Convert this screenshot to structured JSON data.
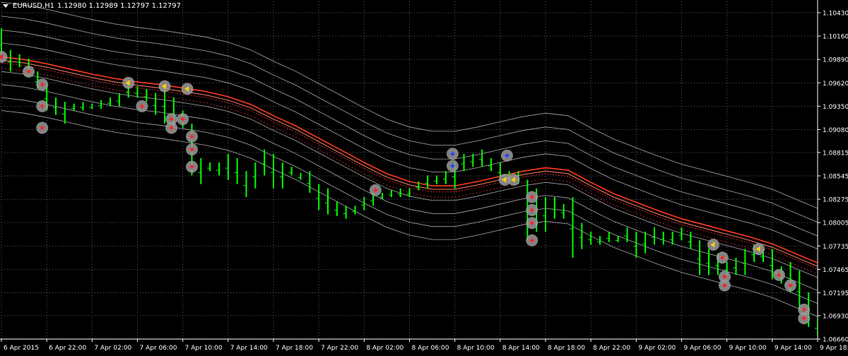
{
  "header": {
    "symbol": "EURUSD,H1",
    "ohlc": "1.12980 1.12989 1.12797 1.12797"
  },
  "colors": {
    "background": "#000000",
    "grid": "#5a5a7a",
    "axis_text": "#ffffff",
    "candle": "#00ff00",
    "envelope": "#c8c8c8",
    "ma_main": "#ff3c1e",
    "ma_dash": "#ff2a2a",
    "marker_ring": "#a0a0a0",
    "marker_red": "#ff2020",
    "marker_blue": "#2040ff",
    "marker_yellow": "#ffd000"
  },
  "chart_data": {
    "type": "candlestick",
    "y_ticks": [
      "1.10430",
      "1.10160",
      "1.09890",
      "1.09620",
      "1.09350",
      "1.09080",
      "1.08815",
      "1.08545",
      "1.08275",
      "1.08005",
      "1.07735",
      "1.07465",
      "1.07195",
      "1.06930",
      "1.06660"
    ],
    "x_ticks": [
      "6 Apr 2015",
      "6 Apr 22:00",
      "7 Apr 02:00",
      "7 Apr 06:00",
      "7 Apr 10:00",
      "7 Apr 14:00",
      "7 Apr 18:00",
      "7 Apr 22:00",
      "8 Apr 02:00",
      "8 Apr 06:00",
      "8 Apr 10:00",
      "8 Apr 14:00",
      "8 Apr 18:00",
      "8 Apr 22:00",
      "9 Apr 02:00",
      "9 Apr 06:00",
      "9 Apr 10:00",
      "9 Apr 14:00",
      "9 Apr 18:00"
    ],
    "ylim": [
      1.0666,
      1.1043
    ],
    "ma_curve": [
      [
        0,
        1.099
      ],
      [
        0.5,
        1.0987
      ],
      [
        1,
        1.0982
      ],
      [
        1.5,
        1.0976
      ],
      [
        2,
        1.097
      ],
      [
        2.5,
        1.0965
      ],
      [
        3,
        1.0961
      ],
      [
        3.5,
        1.0958
      ],
      [
        4,
        1.0954
      ],
      [
        4.5,
        1.095
      ],
      [
        5,
        1.0944
      ],
      [
        5.5,
        1.0935
      ],
      [
        6,
        1.0922
      ],
      [
        6.5,
        1.091
      ],
      [
        7,
        1.0896
      ],
      [
        7.5,
        1.0882
      ],
      [
        8,
        1.0868
      ],
      [
        8.5,
        1.0855
      ],
      [
        9,
        1.0846
      ],
      [
        9.5,
        1.0841
      ],
      [
        10,
        1.0841
      ],
      [
        10.5,
        1.0846
      ],
      [
        11,
        1.0852
      ],
      [
        11.5,
        1.0858
      ],
      [
        12,
        1.0862
      ],
      [
        12.5,
        1.0859
      ],
      [
        13,
        1.0845
      ],
      [
        13.5,
        1.0832
      ],
      [
        14,
        1.0822
      ],
      [
        14.5,
        1.0812
      ],
      [
        15,
        1.0803
      ],
      [
        15.5,
        1.0796
      ],
      [
        16,
        1.0789
      ],
      [
        16.5,
        1.0782
      ],
      [
        17,
        1.0774
      ],
      [
        17.5,
        1.0763
      ],
      [
        18,
        1.0752
      ],
      [
        18.4,
        1.0747
      ]
    ],
    "envelope_offsets": [
      0.0065,
      0.0049,
      0.0033,
      0.0018,
      -0.0015,
      -0.003,
      -0.0045,
      -0.006
    ],
    "candles": [
      [
        0,
        1.1025,
        1.099
      ],
      [
        0.2,
        1.1,
        1.0975
      ],
      [
        0.4,
        1.0995,
        1.098
      ],
      [
        0.6,
        1.099,
        1.097
      ],
      [
        0.8,
        1.0975,
        1.0955
      ],
      [
        1,
        1.096,
        1.093
      ],
      [
        1.2,
        1.0945,
        1.0925
      ],
      [
        1.4,
        1.094,
        1.0915
      ],
      [
        1.6,
        1.0938,
        1.093
      ],
      [
        1.8,
        1.094,
        1.093
      ],
      [
        2,
        1.0938,
        1.0932
      ],
      [
        2.2,
        1.0942,
        1.0932
      ],
      [
        2.4,
        1.0945,
        1.0935
      ],
      [
        2.6,
        1.095,
        1.0935
      ],
      [
        2.8,
        1.096,
        1.0945
      ],
      [
        3,
        1.0958,
        1.0945
      ],
      [
        3.2,
        1.0955,
        1.094
      ],
      [
        3.4,
        1.095,
        1.0925
      ],
      [
        3.6,
        1.0958,
        1.0915
      ],
      [
        3.8,
        1.0945,
        1.091
      ],
      [
        4,
        1.093,
        1.091
      ],
      [
        4.2,
        1.0915,
        1.0855
      ],
      [
        4.4,
        1.0875,
        1.0845
      ],
      [
        4.6,
        1.087,
        1.086
      ],
      [
        4.8,
        1.087,
        1.0855
      ],
      [
        5,
        1.088,
        1.085
      ],
      [
        5.2,
        1.0875,
        1.0845
      ],
      [
        5.4,
        1.086,
        1.083
      ],
      [
        5.6,
        1.087,
        1.084
      ],
      [
        5.8,
        1.0885,
        1.0855
      ],
      [
        6,
        1.088,
        1.084
      ],
      [
        6.2,
        1.087,
        1.084
      ],
      [
        6.4,
        1.0865,
        1.0855
      ],
      [
        6.6,
        1.0858,
        1.085
      ],
      [
        6.8,
        1.086,
        1.0835
      ],
      [
        7,
        1.0845,
        1.0815
      ],
      [
        7.2,
        1.084,
        1.081
      ],
      [
        7.4,
        1.0825,
        1.0808
      ],
      [
        7.6,
        1.082,
        1.0805
      ],
      [
        7.8,
        1.082,
        1.081
      ],
      [
        8,
        1.083,
        1.0815
      ],
      [
        8.2,
        1.0835,
        1.082
      ],
      [
        8.4,
        1.0835,
        1.0828
      ],
      [
        8.6,
        1.0838,
        1.083
      ],
      [
        8.8,
        1.084,
        1.083
      ],
      [
        9,
        1.084,
        1.083
      ],
      [
        9.2,
        1.0848,
        1.0838
      ],
      [
        9.4,
        1.0855,
        1.084
      ],
      [
        9.6,
        1.0855,
        1.0845
      ],
      [
        9.8,
        1.086,
        1.0845
      ],
      [
        10,
        1.087,
        1.084
      ],
      [
        10.2,
        1.088,
        1.086
      ],
      [
        10.4,
        1.088,
        1.0865
      ],
      [
        10.6,
        1.0885,
        1.0865
      ],
      [
        10.8,
        1.0875,
        1.086
      ],
      [
        11,
        1.087,
        1.085
      ],
      [
        11.2,
        1.086,
        1.0848
      ],
      [
        11.4,
        1.086,
        1.0845
      ],
      [
        11.6,
        1.085,
        1.078
      ],
      [
        11.8,
        1.084,
        1.079
      ],
      [
        12,
        1.083,
        1.079
      ],
      [
        12.2,
        1.083,
        1.0805
      ],
      [
        12.4,
        1.0822,
        1.0805
      ],
      [
        12.6,
        1.083,
        1.076
      ],
      [
        12.8,
        1.08,
        1.077
      ],
      [
        13,
        1.079,
        1.0775
      ],
      [
        13.2,
        1.0785,
        1.0775
      ],
      [
        13.4,
        1.079,
        1.0778
      ],
      [
        13.6,
        1.0785,
        1.0778
      ],
      [
        13.8,
        1.0795,
        1.0778
      ],
      [
        14,
        1.079,
        1.076
      ],
      [
        14.2,
        1.079,
        1.0765
      ],
      [
        14.4,
        1.0795,
        1.0775
      ],
      [
        14.6,
        1.079,
        1.0775
      ],
      [
        14.8,
        1.079,
        1.0775
      ],
      [
        15,
        1.0795,
        1.078
      ],
      [
        15.2,
        1.079,
        1.077
      ],
      [
        15.4,
        1.078,
        1.074
      ],
      [
        15.6,
        1.077,
        1.074
      ],
      [
        15.8,
        1.0765,
        1.074
      ],
      [
        16,
        1.0755,
        1.074
      ],
      [
        16.2,
        1.076,
        1.074
      ],
      [
        16.4,
        1.077,
        1.074
      ],
      [
        16.6,
        1.0775,
        1.0755
      ],
      [
        16.8,
        1.077,
        1.0755
      ],
      [
        17,
        1.077,
        1.0735
      ],
      [
        17.2,
        1.075,
        1.073
      ],
      [
        17.4,
        1.0755,
        1.072
      ],
      [
        17.6,
        1.0745,
        1.07
      ],
      [
        17.8,
        1.072,
        1.068
      ],
      [
        18,
        1.069,
        1.067
      ],
      [
        18.2,
        1.068,
        1.0665
      ],
      [
        18.35,
        1.0675,
        1.066
      ]
    ],
    "markers": [
      [
        0,
        1.0992,
        "red-left"
      ],
      [
        0.6,
        1.0975,
        "red"
      ],
      [
        0.9,
        1.096,
        "red"
      ],
      [
        0.9,
        1.0935,
        "red"
      ],
      [
        0.9,
        1.091,
        "red"
      ],
      [
        2.8,
        1.0962,
        "yellow-left"
      ],
      [
        3.1,
        1.0935,
        "red"
      ],
      [
        3.6,
        1.0958,
        "yellow-left"
      ],
      [
        3.75,
        1.092,
        "red"
      ],
      [
        3.75,
        1.091,
        "red"
      ],
      [
        4.0,
        1.092,
        "red"
      ],
      [
        4.1,
        1.0955,
        "yellow-left"
      ],
      [
        4.2,
        1.09,
        "red"
      ],
      [
        4.2,
        1.0885,
        "red"
      ],
      [
        4.2,
        1.0865,
        "red"
      ],
      [
        8.25,
        1.0838,
        "red"
      ],
      [
        9.95,
        1.088,
        "blue"
      ],
      [
        9.95,
        1.0866,
        "blue"
      ],
      [
        11.15,
        1.0878,
        "blue"
      ],
      [
        11.1,
        1.085,
        "yellow-left"
      ],
      [
        11.3,
        1.085,
        "yellow-left"
      ],
      [
        11.7,
        1.083,
        "red"
      ],
      [
        11.7,
        1.0815,
        "red"
      ],
      [
        11.7,
        1.08,
        "red"
      ],
      [
        11.7,
        1.078,
        "red"
      ],
      [
        15.7,
        1.0775,
        "yellow-left"
      ],
      [
        15.9,
        1.076,
        "red"
      ],
      [
        15.95,
        1.0738,
        "red"
      ],
      [
        15.95,
        1.0728,
        "red"
      ],
      [
        16.7,
        1.077,
        "yellow-left"
      ],
      [
        17.15,
        1.074,
        "red"
      ],
      [
        17.4,
        1.0728,
        "red"
      ],
      [
        17.7,
        1.07,
        "red"
      ],
      [
        17.7,
        1.069,
        "red"
      ]
    ]
  }
}
